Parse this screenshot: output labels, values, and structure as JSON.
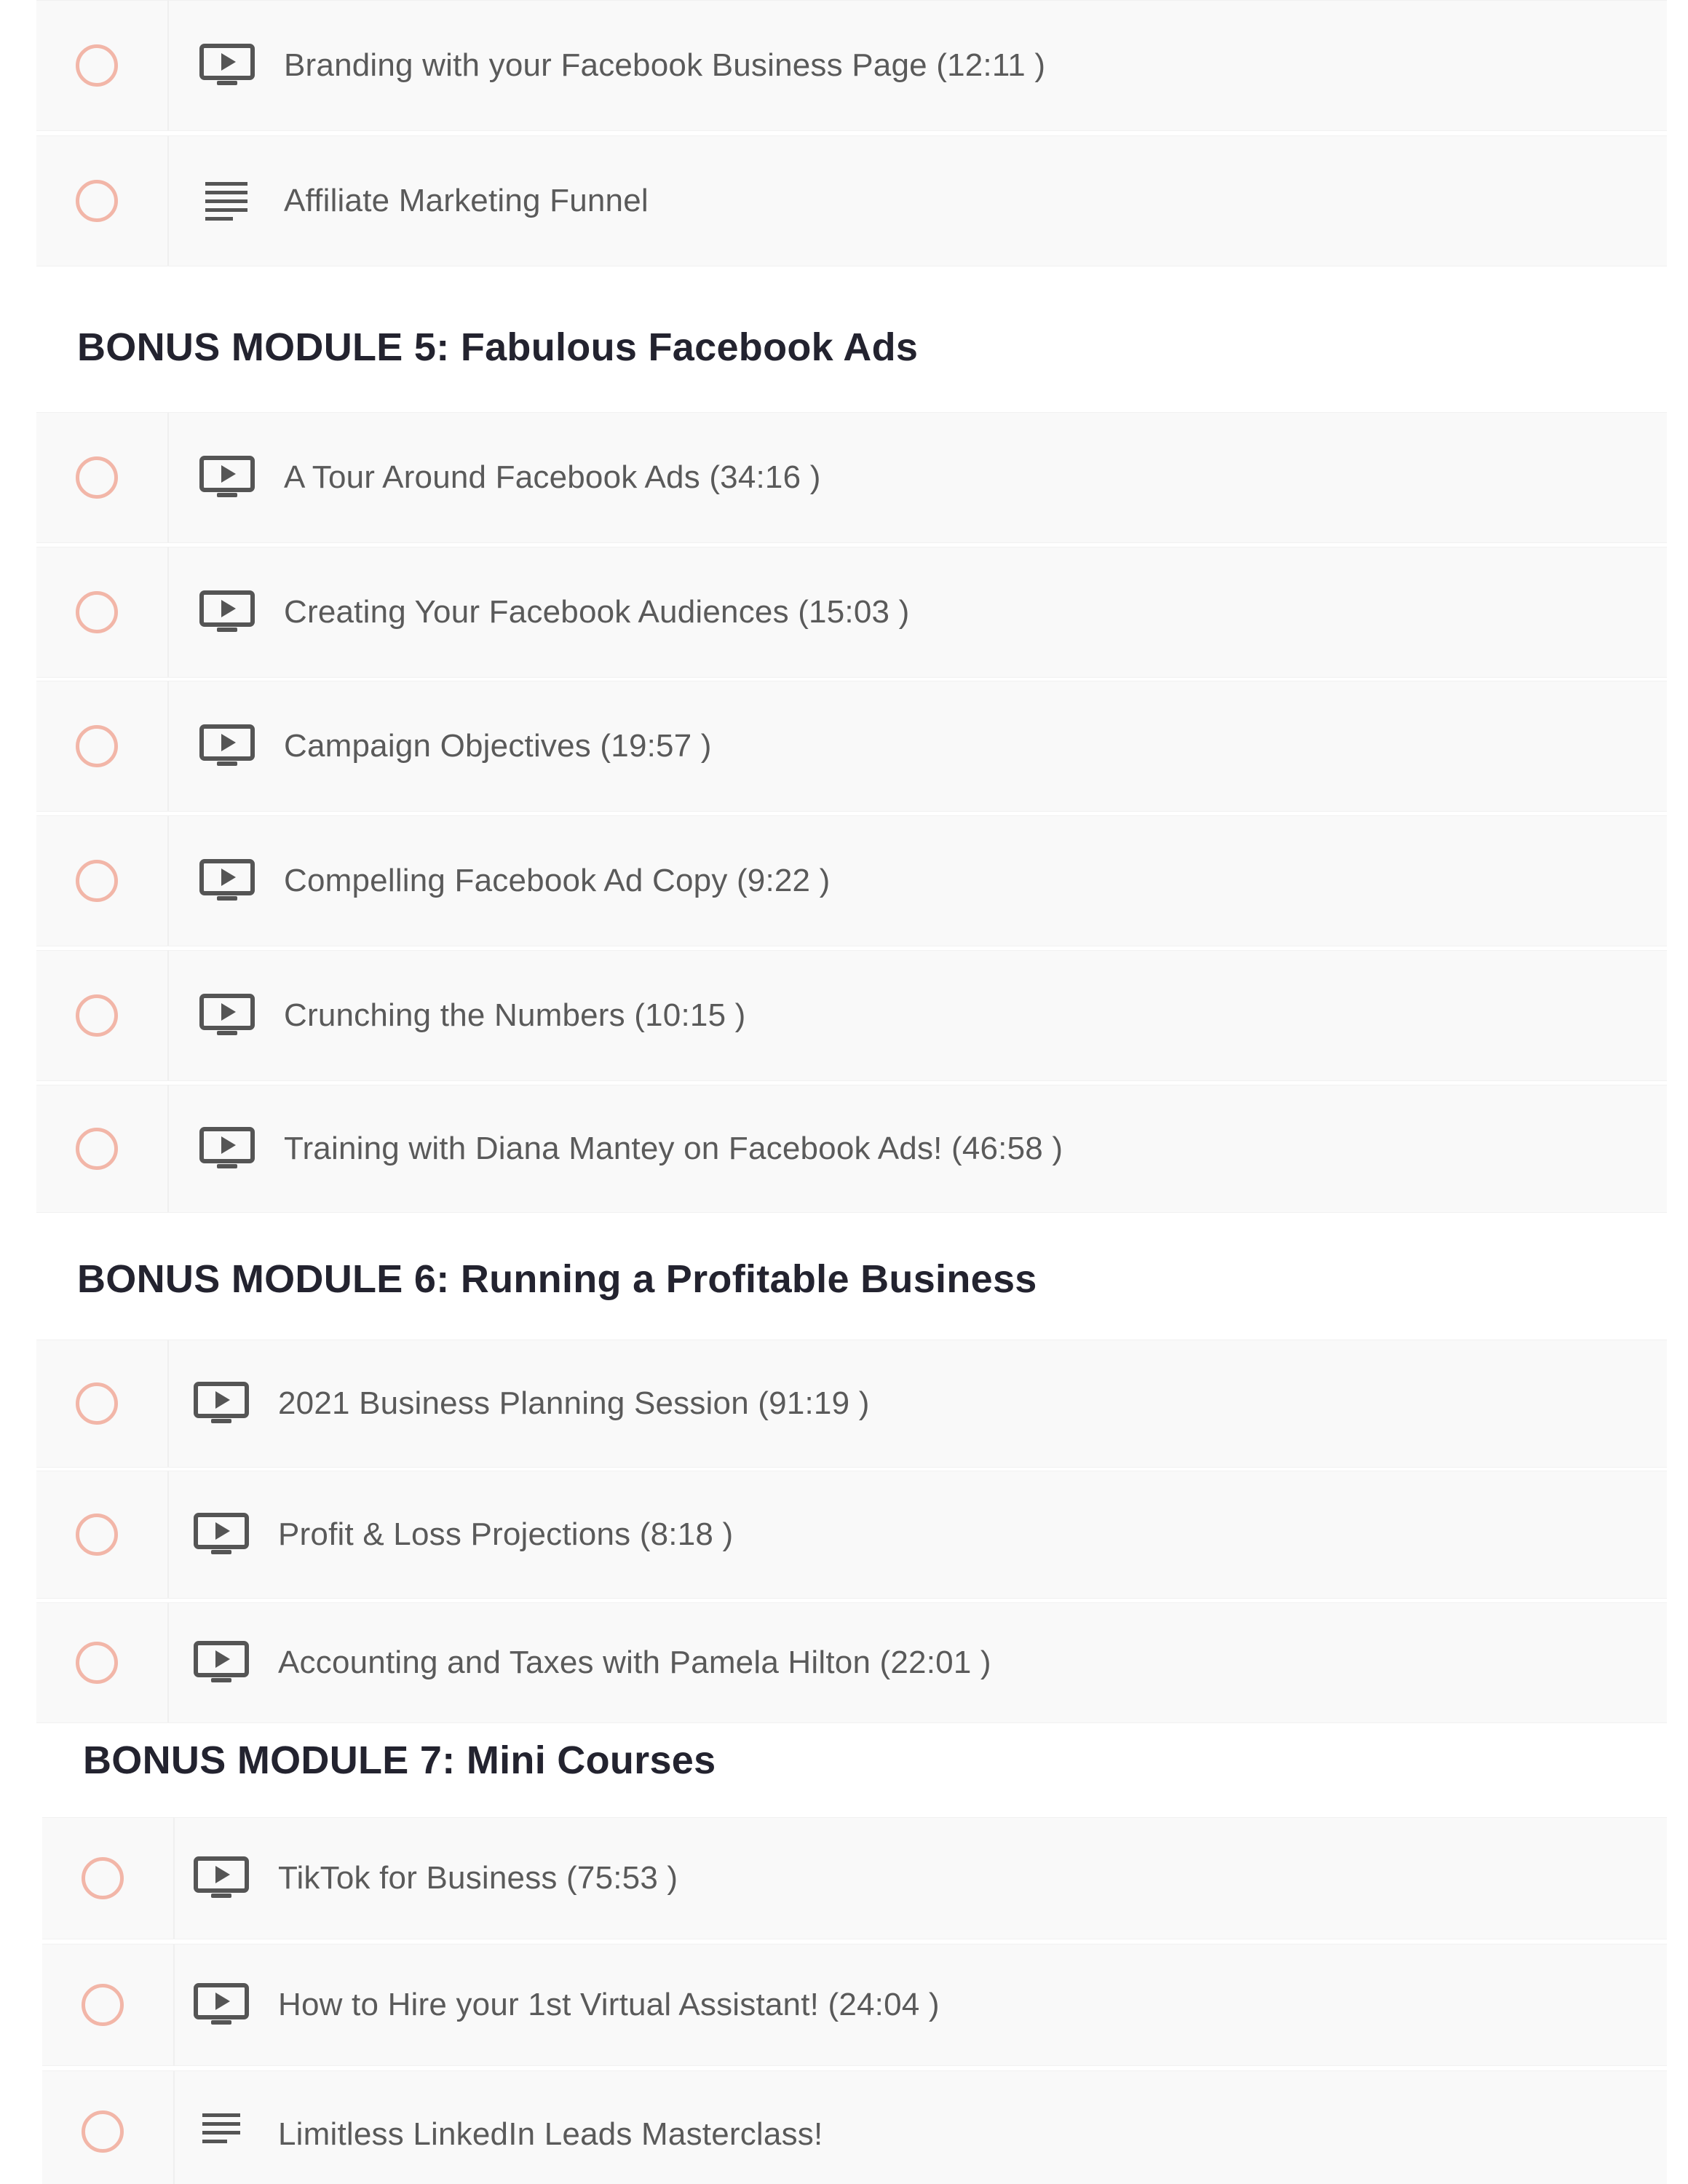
{
  "modules": [
    {
      "title": "",
      "lessons": [
        {
          "type": "video",
          "icon": "play-screen-icon",
          "label": "Branding with your Facebook Business Page (12:11 )"
        },
        {
          "type": "text",
          "icon": "text-lines-icon",
          "label": "Affiliate Marketing Funnel"
        }
      ]
    },
    {
      "title": "BONUS MODULE 5: Fabulous Facebook Ads",
      "lessons": [
        {
          "type": "video",
          "icon": "play-screen-icon",
          "label": "A Tour Around Facebook Ads (34:16 )"
        },
        {
          "type": "video",
          "icon": "play-screen-icon",
          "label": "Creating Your Facebook Audiences (15:03 )"
        },
        {
          "type": "video",
          "icon": "play-screen-icon",
          "label": "Campaign Objectives (19:57 )"
        },
        {
          "type": "video",
          "icon": "play-screen-icon",
          "label": "Compelling Facebook Ad Copy (9:22 )"
        },
        {
          "type": "video",
          "icon": "play-screen-icon",
          "label": "Crunching the Numbers (10:15 )"
        },
        {
          "type": "video",
          "icon": "play-screen-icon",
          "label": "Training with Diana Mantey on Facebook Ads! (46:58 )"
        }
      ]
    },
    {
      "title": "BONUS MODULE 6: Running a Profitable Business",
      "lessons": [
        {
          "type": "video",
          "icon": "play-screen-icon",
          "label": "2021 Business Planning Session (91:19 )"
        },
        {
          "type": "video",
          "icon": "play-screen-icon",
          "label": "Profit & Loss Projections (8:18 )"
        },
        {
          "type": "video",
          "icon": "play-screen-icon",
          "label": "Accounting and Taxes with Pamela Hilton (22:01 )"
        }
      ]
    },
    {
      "title": "BONUS MODULE 7: Mini Courses",
      "lessons": [
        {
          "type": "video",
          "icon": "play-screen-icon",
          "label": "TikTok for Business (75:53 )"
        },
        {
          "type": "video",
          "icon": "play-screen-icon",
          "label": "How to Hire your 1st Virtual Assistant! (24:04 )"
        },
        {
          "type": "text",
          "icon": "text-lines-icon",
          "label": "Limitless LinkedIn Leads Masterclass!"
        }
      ]
    }
  ],
  "colors": {
    "row_background": "#f9f9f9",
    "status_circle": "#f2b6a8",
    "lesson_text": "#5a5a5a",
    "module_title_text": "#23232f",
    "icon": "#555555"
  }
}
